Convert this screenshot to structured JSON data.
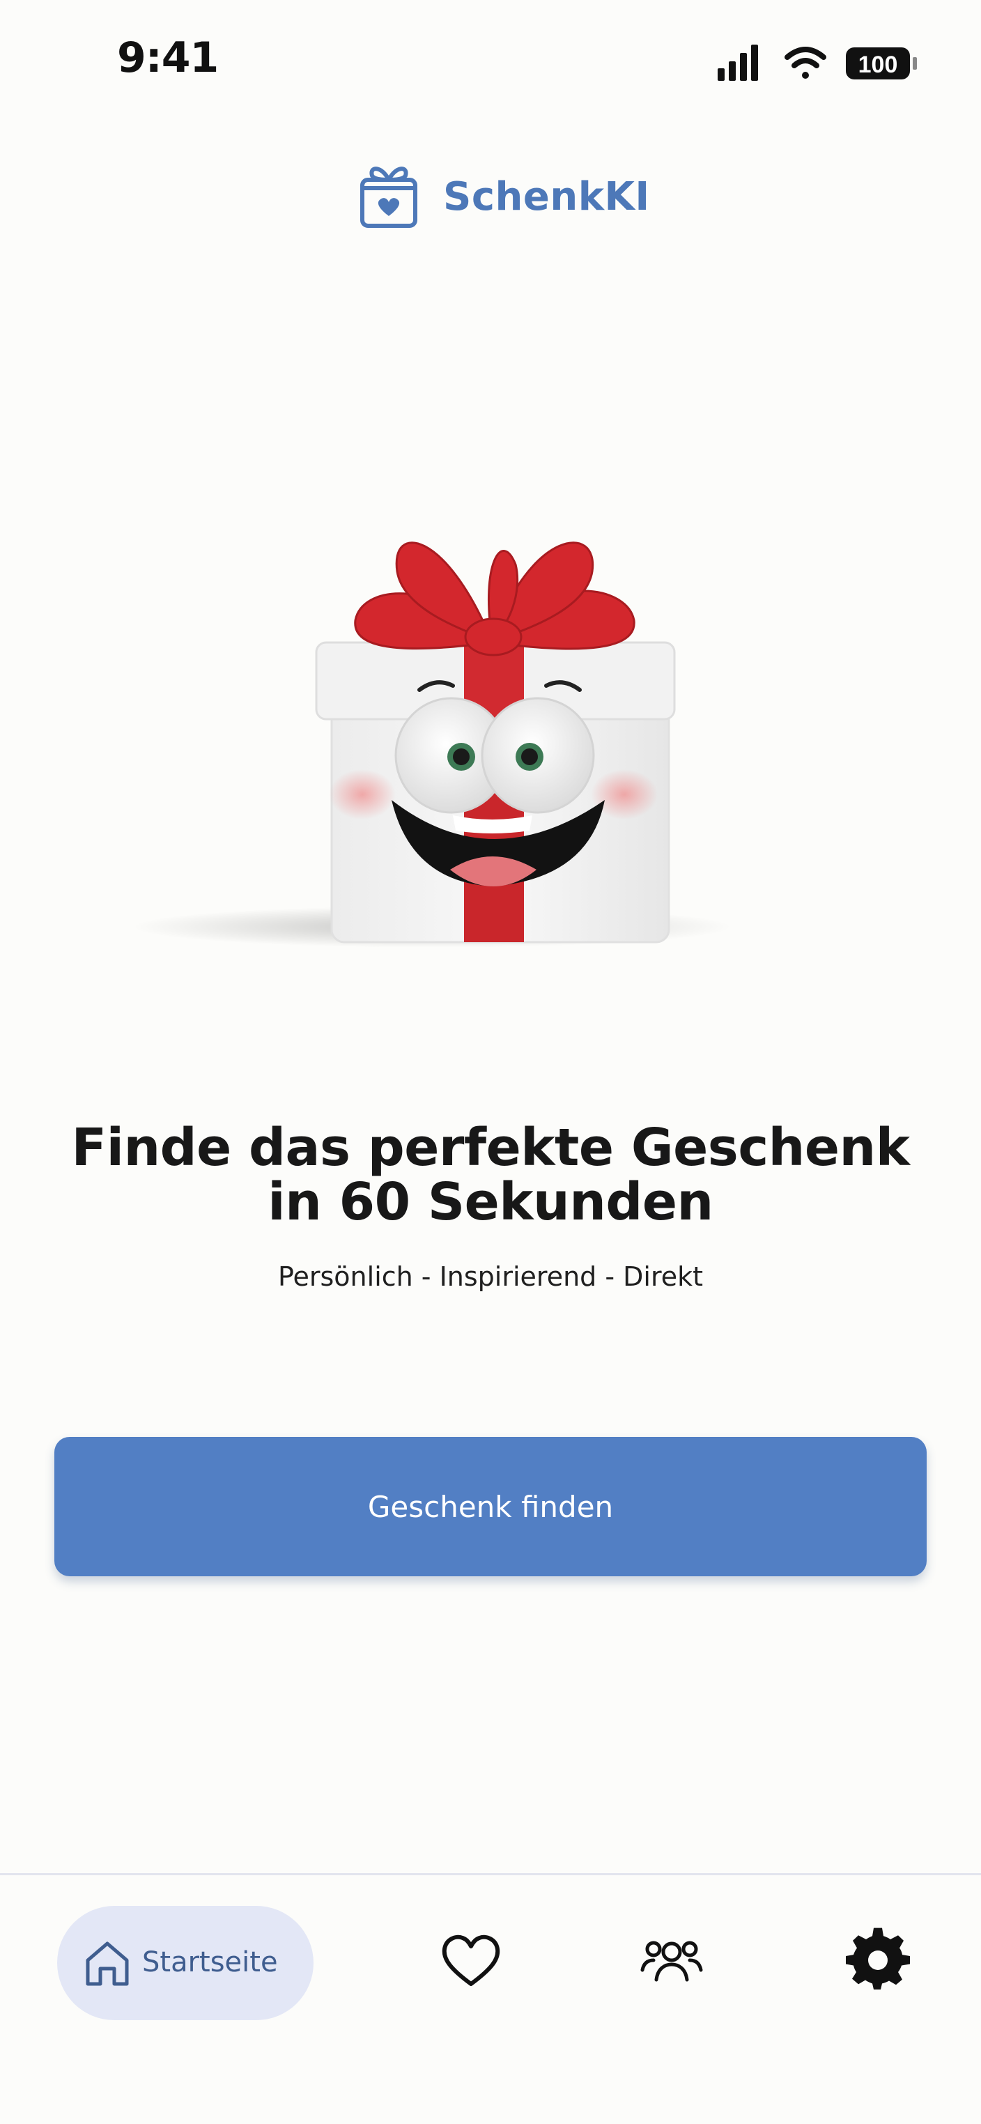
{
  "status_bar": {
    "time": "9:41",
    "battery": "100"
  },
  "brand": {
    "name": "SchenkKI",
    "icon": "gift-heart-icon",
    "color": "#4d78b8"
  },
  "hero": {
    "image": "smiling-gift-box-illustration"
  },
  "main": {
    "headline": "Finde das perfekte Geschenk in 60 Sekunden",
    "subline": "Persönlich - Inspirierend - Direkt",
    "cta_label": "Geschenk finden",
    "cta_color": "#527fc4"
  },
  "bottom_nav": {
    "items": [
      {
        "label": "Startseite",
        "icon": "home-icon",
        "active": true
      },
      {
        "icon": "heart-icon",
        "active": false
      },
      {
        "icon": "people-icon",
        "active": false
      },
      {
        "icon": "gear-icon",
        "active": false
      }
    ],
    "active_bg": "#e3e7f6"
  }
}
